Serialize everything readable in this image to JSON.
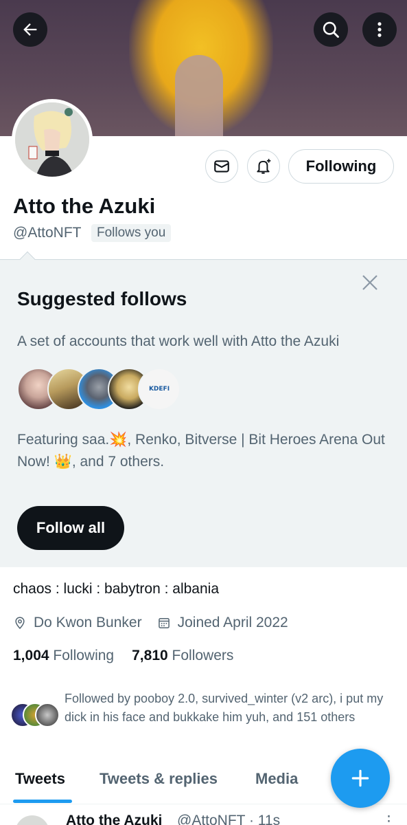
{
  "profile": {
    "name": "Atto the Azuki",
    "handle": "@AttoNFT",
    "follows_you": "Follows you",
    "following_button": "Following",
    "bio": "chaos : lucki : babytron : albania",
    "location": "Do Kwon Bunker",
    "joined": "Joined April 2022",
    "following_count": "1,004",
    "following_label": "Following",
    "followers_count": "7,810",
    "followers_label": "Followers",
    "followed_by": "Followed by pooboy 2.0, survived_winter (v2 arc), i put my dick in his face and bukkake him yuh, and 151 others"
  },
  "suggested": {
    "title": "Suggested follows",
    "subtitle": "A set of accounts that work well with Atto the Azuki",
    "featuring": "Featuring saa.💥, Renko, Bitverse | Bit Heroes Arena Out Now! 👑, and 7 others.",
    "follow_all": "Follow all",
    "kdefi_label": "KDEFI"
  },
  "tabs": [
    {
      "label": "Tweets",
      "active": true
    },
    {
      "label": "Tweets & replies",
      "active": false
    },
    {
      "label": "Media",
      "active": false
    }
  ],
  "tweet_peek": {
    "name": "Atto the Azuki",
    "handle": "@AttoNFT · 11s",
    "more": "⋮"
  },
  "icons": {
    "back": "arrow-left-icon",
    "search": "search-icon",
    "more": "more-vertical-icon",
    "message": "mail-icon",
    "notify": "bell-plus-icon",
    "close": "close-icon",
    "location": "location-pin-icon",
    "calendar": "calendar-icon",
    "compose": "plus-icon"
  },
  "colors": {
    "accent": "#1d9bf0",
    "text": "#0f1419",
    "muted": "#536471",
    "panel": "#eff3f4"
  }
}
